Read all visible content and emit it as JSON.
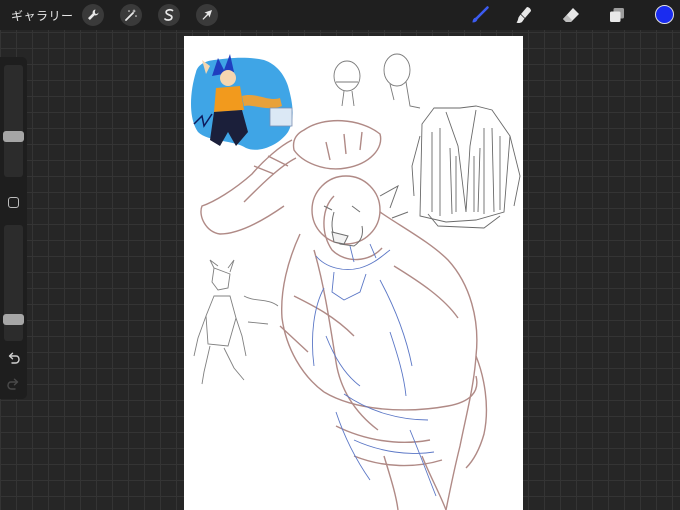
{
  "toolbar": {
    "gallery_label": "ギャラリー",
    "left_tools": [
      {
        "name": "actions",
        "icon": "wrench-icon"
      },
      {
        "name": "adjustments",
        "icon": "magic-wand-icon"
      },
      {
        "name": "selection",
        "icon": "selection-s-icon"
      },
      {
        "name": "transform",
        "icon": "arrow-cursor-icon"
      }
    ],
    "right_tools": [
      {
        "name": "brush",
        "icon": "brush-icon",
        "active": true
      },
      {
        "name": "smudge",
        "icon": "smudge-icon",
        "active": false
      },
      {
        "name": "eraser",
        "icon": "eraser-icon",
        "active": false
      },
      {
        "name": "layers",
        "icon": "layers-icon",
        "active": false
      }
    ],
    "current_color": "#1a2cf0"
  },
  "sidebar": {
    "brush_size_level": 0.35,
    "opacity_level": 0.15,
    "modify_button_icon": "square-icon",
    "undo_icon": "undo-icon",
    "redo_icon": "redo-icon"
  },
  "colors": {
    "app_background": "#262626",
    "toolbar_background": "#1f1f1f",
    "active_tool": "#3c5cf0",
    "sketch_brown": "#b08a86",
    "sketch_blue": "#5b77c6",
    "sketch_gray": "#6f6f6f"
  }
}
